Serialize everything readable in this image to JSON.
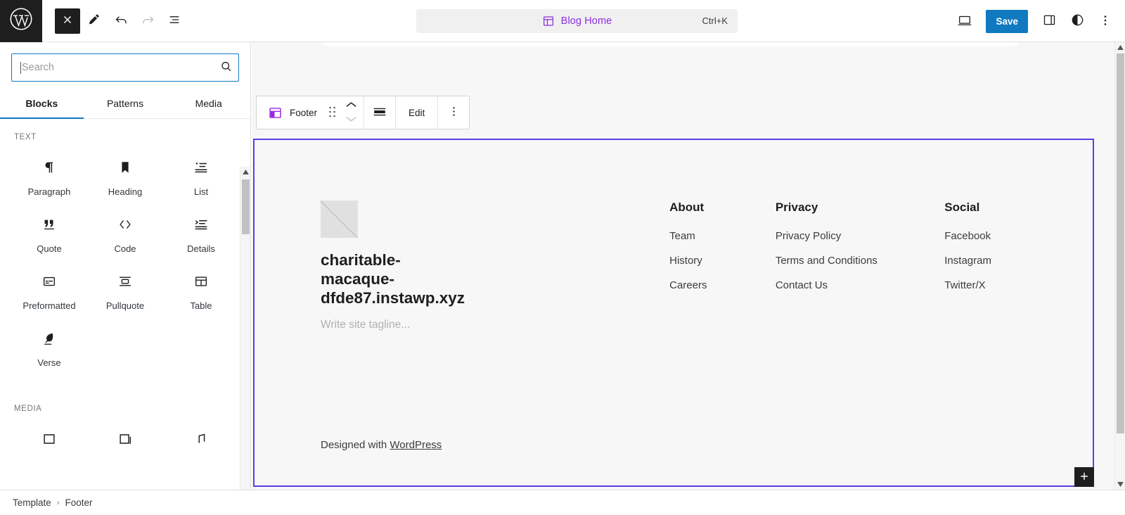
{
  "header": {
    "logo_icon": "wordpress-logo-icon",
    "tools": [
      {
        "name": "close-inserter-button",
        "icon": "close-x-icon",
        "state": "active"
      },
      {
        "name": "edit-tools-button",
        "icon": "pencil-icon",
        "state": "default"
      },
      {
        "name": "undo-button",
        "icon": "undo-arrow-icon",
        "state": "default"
      },
      {
        "name": "redo-button",
        "icon": "redo-arrow-icon",
        "state": "disabled"
      },
      {
        "name": "list-view-button",
        "icon": "list-view-icon",
        "state": "default"
      }
    ],
    "document_title": "Blog Home",
    "document_title_icon": "template-part-icon",
    "command_shortcut": "Ctrl+K",
    "view_button_icon": "desktop-preview-icon",
    "save_label": "Save",
    "settings_icon": "settings-sidebar-icon",
    "styles_icon": "global-styles-icon",
    "more_icon": "more-options-vertical-icon",
    "accent_blue": "#1079c0",
    "accent_purple": "#8b2fe0"
  },
  "inserter": {
    "search": {
      "value": "",
      "placeholder": "Search",
      "icon": "search-icon"
    },
    "tabs": [
      {
        "label": "Blocks",
        "active": true
      },
      {
        "label": "Patterns",
        "active": false
      },
      {
        "label": "Media",
        "active": false
      }
    ],
    "sections": [
      {
        "label": "TEXT",
        "blocks": [
          {
            "label": "Paragraph",
            "icon": "paragraph-icon"
          },
          {
            "label": "Heading",
            "icon": "heading-bookmark-icon"
          },
          {
            "label": "List",
            "icon": "list-icon"
          },
          {
            "label": "Quote",
            "icon": "quote-icon"
          },
          {
            "label": "Code",
            "icon": "code-icon"
          },
          {
            "label": "Details",
            "icon": "details-icon"
          },
          {
            "label": "Preformatted",
            "icon": "preformatted-icon"
          },
          {
            "label": "Pullquote",
            "icon": "pullquote-icon"
          },
          {
            "label": "Table",
            "icon": "table-icon"
          },
          {
            "label": "Verse",
            "icon": "verse-quill-icon"
          }
        ]
      },
      {
        "label": "MEDIA",
        "blocks": []
      }
    ]
  },
  "block_toolbar": {
    "block_name": "Footer",
    "block_icon": "template-part-purple-icon",
    "drag_handle_icon": "drag-handle-icon",
    "move_up_icon": "chevron-up-icon",
    "move_down_icon": "chevron-down-icon",
    "align_icon": "align-full-width-icon",
    "edit_label": "Edit",
    "more_icon": "more-options-vertical-icon"
  },
  "canvas": {
    "selection_color": "#5a3ee8",
    "footer": {
      "site_logo_icon": "site-logo-placeholder-icon",
      "site_title": "charitable-macaque-dfde87.instawp.xyz",
      "site_tagline_placeholder": "Write site tagline...",
      "columns": [
        {
          "heading": "About",
          "links": [
            "Team",
            "History",
            "Careers"
          ]
        },
        {
          "heading": "Privacy",
          "links": [
            "Privacy Policy",
            "Terms and Conditions",
            "Contact Us"
          ]
        },
        {
          "heading": "Social",
          "links": [
            "Facebook",
            "Instagram",
            "Twitter/X"
          ]
        }
      ],
      "credit_prefix": "Designed with ",
      "credit_link": "WordPress"
    },
    "add_block_icon": "plus-icon"
  },
  "breadcrumb": {
    "items": [
      "Template",
      "Footer"
    ],
    "separator": "›"
  }
}
